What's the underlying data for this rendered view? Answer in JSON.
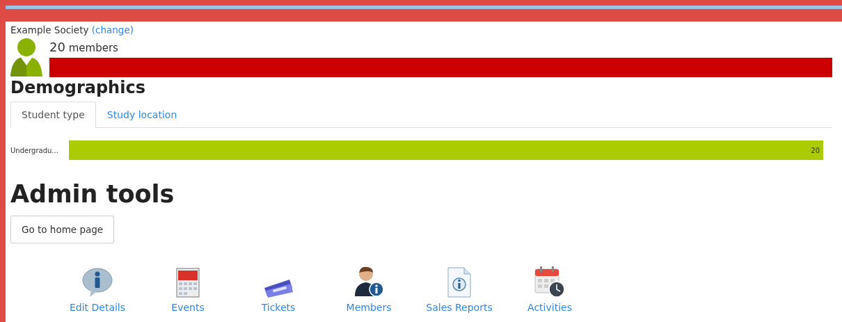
{
  "society": {
    "name": "Example Society",
    "change_link": "(change)"
  },
  "membership": {
    "count": "20",
    "label": "members"
  },
  "demographics": {
    "title": "Demographics",
    "tabs": [
      {
        "label": "Student type",
        "selected": true
      },
      {
        "label": "Study location",
        "selected": false
      }
    ],
    "rows": [
      {
        "label": "Undergradu...",
        "value": "20"
      }
    ]
  },
  "admin": {
    "title": "Admin tools",
    "button": "Go to home page",
    "tools": [
      {
        "label": "Edit Details",
        "kind": "info"
      },
      {
        "label": "Events",
        "kind": "calendar"
      },
      {
        "label": "Tickets",
        "kind": "ticket"
      },
      {
        "label": "Members",
        "kind": "person"
      },
      {
        "label": "Sales Reports",
        "kind": "report"
      },
      {
        "label": "Activities",
        "kind": "schedule"
      }
    ]
  }
}
